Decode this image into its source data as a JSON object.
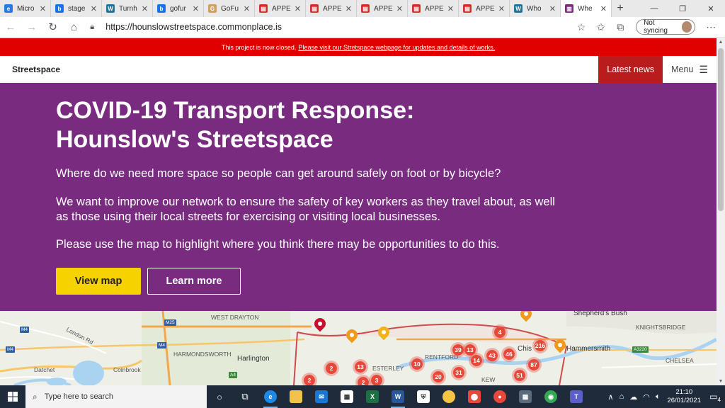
{
  "browser": {
    "tabs": [
      {
        "label": "Micro",
        "icon": "edge-icon",
        "color": "#2a7ae2"
      },
      {
        "label": "stage",
        "icon": "bing-icon",
        "color": "#1a73e8"
      },
      {
        "label": "Turnh",
        "icon": "wordpress-icon",
        "color": "#21759b"
      },
      {
        "label": "gofur",
        "icon": "bing-icon",
        "color": "#1a73e8"
      },
      {
        "label": "GoFu",
        "icon": "gofundme-icon",
        "color": "#d0a060"
      },
      {
        "label": "APPE",
        "icon": "pdf-icon",
        "color": "#d32f2f"
      },
      {
        "label": "APPE",
        "icon": "pdf-icon",
        "color": "#d32f2f"
      },
      {
        "label": "APPE",
        "icon": "pdf-icon",
        "color": "#d32f2f"
      },
      {
        "label": "APPE",
        "icon": "pdf-icon",
        "color": "#d32f2f"
      },
      {
        "label": "APPE",
        "icon": "pdf-icon",
        "color": "#d32f2f"
      },
      {
        "label": "Who",
        "icon": "wordpress-icon",
        "color": "#21759b"
      },
      {
        "label": "Whe",
        "icon": "commonplace-icon",
        "color": "#792b80"
      }
    ],
    "url": "https://hounslowstreetspace.commonplace.is",
    "sync_label": "Not syncing"
  },
  "banner": {
    "text": "This project is now closed.",
    "link": "Please visit our Stretspace webpage for updates and details of works."
  },
  "header": {
    "brand": "Streetspace",
    "latest_news": "Latest news",
    "menu": "Menu"
  },
  "hero": {
    "title_line1": "COVID-19 Transport Response:",
    "title_line2": "Hounslow's Streetspace",
    "para1": "Where do we need more space so people can get around safely on foot or by bicycle?",
    "para2": "We want to improve our network to ensure the safety of key workers as they travel about, as well as those using their local streets for exercising or visiting local businesses.",
    "para3": "Please use the map to highlight where you think there may be opportunities to do this.",
    "view_map": "View map",
    "learn_more": "Learn more"
  },
  "map": {
    "labels": [
      "WEST DRAYTON",
      "HARMONDSWORTH",
      "Harlington",
      "Datchet",
      "Colnbrook",
      "London Rd",
      "Shepherd's Bush",
      "KNIGHTSBRIDGE",
      "Hammersmith",
      "CHELSEA",
      "Chis",
      "RENTFORD",
      "ESTERLEY",
      "KEW"
    ],
    "clusters": [
      "4",
      "216",
      "39",
      "13",
      "43",
      "46",
      "14",
      "87",
      "51",
      "10",
      "20",
      "31",
      "13",
      "2",
      "2",
      "2",
      "3"
    ],
    "road_badges": [
      "M4",
      "M25",
      "M4",
      "M4",
      "A4",
      "A3220"
    ]
  },
  "taskbar": {
    "search_placeholder": "Type here to search",
    "time": "21:10",
    "date": "26/01/2021",
    "notification_count": "4"
  }
}
